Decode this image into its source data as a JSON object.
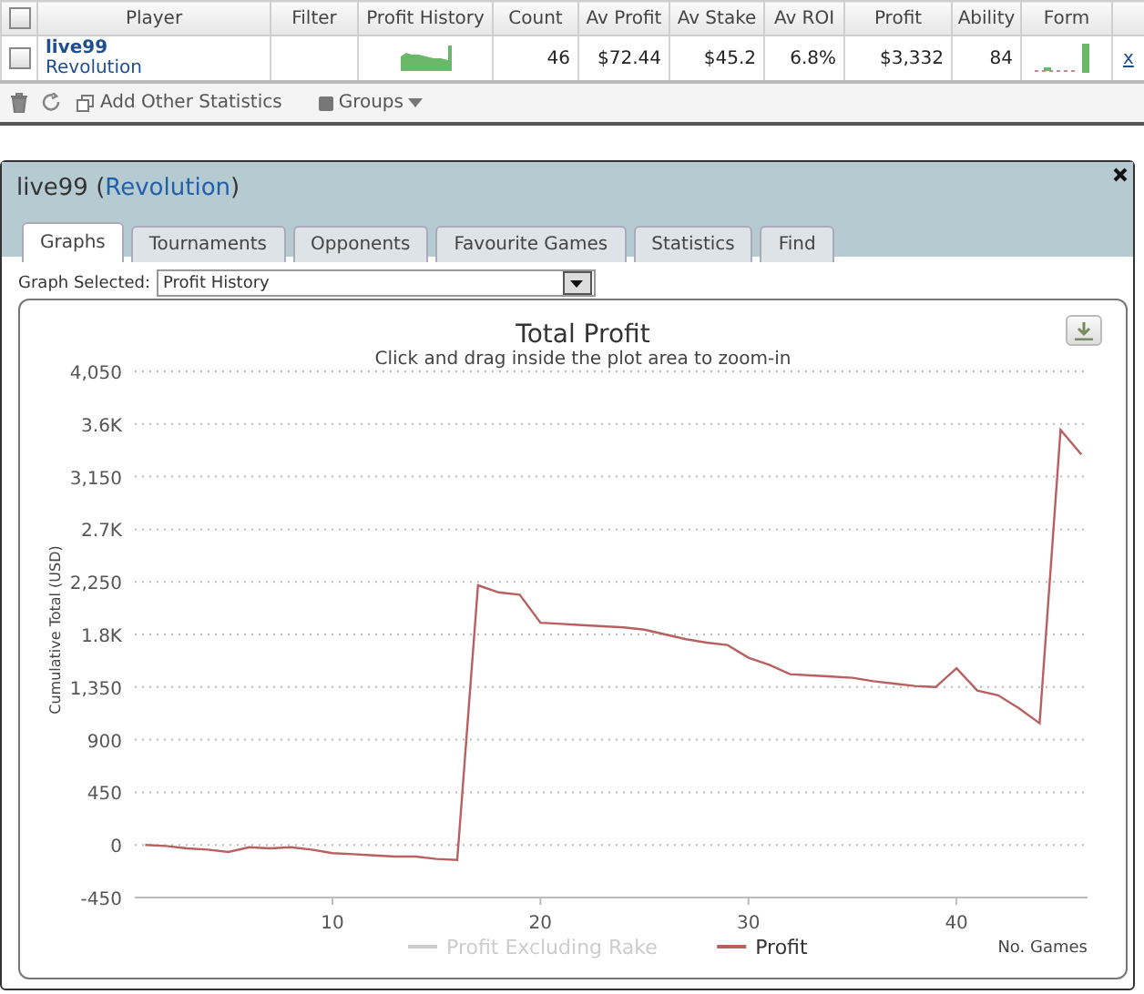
{
  "table": {
    "header_checkbox": {
      "checked": false
    },
    "columns": [
      "Player",
      "Filter",
      "Profit History",
      "Count",
      "Av Profit",
      "Av Stake",
      "Av ROI",
      "Profit",
      "Ability",
      "Form"
    ],
    "rows": [
      {
        "checked": false,
        "player": "live99",
        "site": "Revolution",
        "count": "46",
        "av_profit": "$72.44",
        "av_stake": "$45.2",
        "av_roi": "6.8%",
        "profit": "$3,332",
        "ability": "84",
        "remove": "x"
      }
    ]
  },
  "toolbar": {
    "add_stats": "Add Other Statistics",
    "groups": "Groups"
  },
  "dialog": {
    "title_parts": [
      {
        "kind": "plain",
        "text": "live99 ("
      },
      {
        "kind": "link",
        "text": "Revolution"
      },
      {
        "kind": "plain",
        "text": ")"
      }
    ],
    "tabs": [
      {
        "label": "Graphs",
        "selected": true
      },
      {
        "label": "Tournaments",
        "selected": false
      },
      {
        "label": "Opponents",
        "selected": false
      },
      {
        "label": "Favourite Games",
        "selected": false
      },
      {
        "label": "Statistics",
        "selected": false
      },
      {
        "label": "Find",
        "selected": false
      }
    ],
    "graph_select": {
      "label": "Graph Selected:",
      "value": "Profit History"
    },
    "chart": {
      "subtitle": "Click and drag inside the plot area to zoom-in",
      "legend": [
        {
          "label": "Profit Excluding Rake",
          "visible": false
        }
      ],
      "chart_data": {
        "type": "line",
        "title": "Total Profit",
        "xlabel": "No. Games",
        "ylabel": "Cumulative Total (USD)",
        "x": [
          1,
          2,
          3,
          4,
          5,
          6,
          7,
          8,
          9,
          10,
          11,
          12,
          13,
          14,
          15,
          16,
          17,
          18,
          19,
          20,
          21,
          22,
          23,
          24,
          25,
          26,
          27,
          28,
          29,
          30,
          31,
          32,
          33,
          34,
          35,
          36,
          37,
          38,
          39,
          40,
          41,
          42,
          43,
          44,
          45,
          46
        ],
        "series": [
          {
            "name": "Profit",
            "color": "#b86060",
            "values": [
              0,
              -10,
              -30,
              -40,
              -60,
              -20,
              -30,
              -20,
              -40,
              -70,
              -80,
              -90,
              -100,
              -100,
              -120,
              -130,
              2220,
              2160,
              2140,
              1900,
              1890,
              1880,
              1870,
              1860,
              1840,
              1800,
              1760,
              1730,
              1710,
              1600,
              1540,
              1460,
              1450,
              1440,
              1430,
              1400,
              1380,
              1360,
              1350,
              1510,
              1320,
              1280,
              1170,
              1040,
              3550,
              3340
            ]
          }
        ],
        "grid": true,
        "xlim": [
          0.5,
          46.3
        ],
        "ylim": [
          -450,
          4050
        ],
        "xticks": [
          10,
          20,
          30,
          40
        ],
        "yticks": [
          {
            "value": -450,
            "label": "-450"
          },
          {
            "value": 0,
            "label": "0"
          },
          {
            "value": 450,
            "label": "450"
          },
          {
            "value": 900,
            "label": "900"
          },
          {
            "value": 1350,
            "label": "1,350"
          },
          {
            "value": 1800,
            "label": "1.8K"
          },
          {
            "value": 2250,
            "label": "2,250"
          },
          {
            "value": 2700,
            "label": "2.7K"
          },
          {
            "value": 3150,
            "label": "3,150"
          },
          {
            "value": 3600,
            "label": "3.6K"
          },
          {
            "value": 4050,
            "label": "4,050"
          }
        ]
      }
    }
  }
}
